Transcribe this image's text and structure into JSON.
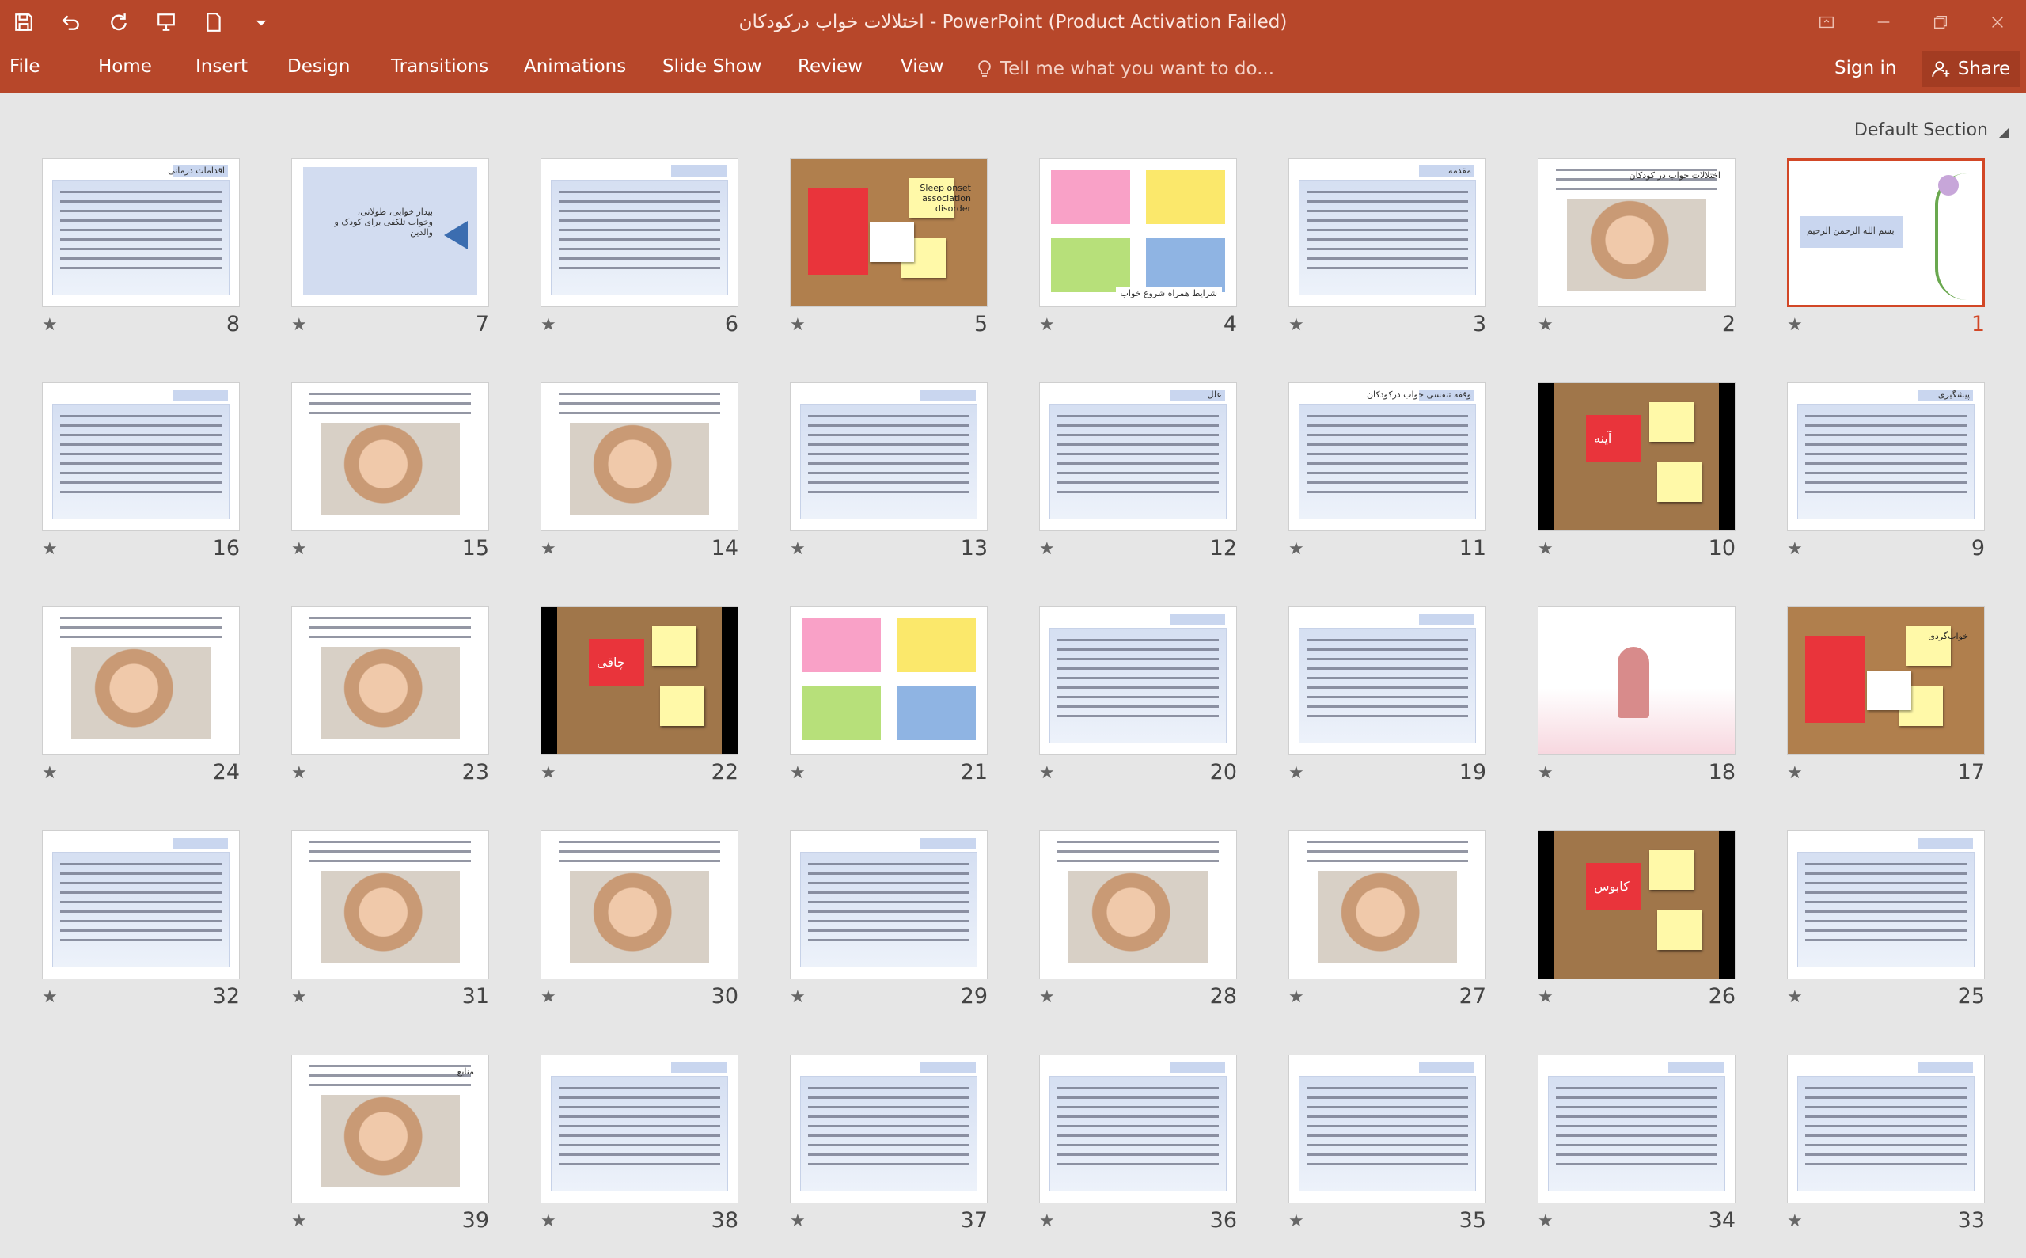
{
  "window": {
    "title": "اختلالات خواب درکودکان - PowerPoint (Product Activation Failed)"
  },
  "ribbon": {
    "tabs": [
      {
        "id": "file",
        "label": "File"
      },
      {
        "id": "home",
        "label": "Home"
      },
      {
        "id": "insert",
        "label": "Insert"
      },
      {
        "id": "design",
        "label": "Design"
      },
      {
        "id": "transitions",
        "label": "Transitions"
      },
      {
        "id": "animations",
        "label": "Animations"
      },
      {
        "id": "slideshow",
        "label": "Slide Show"
      },
      {
        "id": "review",
        "label": "Review"
      },
      {
        "id": "view",
        "label": "View"
      }
    ],
    "tell_me": "Tell me what you want to do...",
    "sign_in": "Sign in",
    "share": "Share"
  },
  "section": {
    "label": "Default Section"
  },
  "slides": [
    {
      "number": "1",
      "selected": true,
      "style": "title",
      "caption": "بسم الله الرحمن الرحیم"
    },
    {
      "number": "2",
      "style": "photo",
      "caption": "اختلالات خواب در کودکان"
    },
    {
      "number": "3",
      "style": "text",
      "caption": "مقدمه"
    },
    {
      "number": "4",
      "style": "sticky",
      "caption": "شرایط همراه شروع خواب"
    },
    {
      "number": "5",
      "style": "cork",
      "caption": "Sleep onset association disorder"
    },
    {
      "number": "6",
      "style": "text",
      "caption": ""
    },
    {
      "number": "7",
      "style": "arrow",
      "caption": "بیدار خوابی، طولانی، وخواب تلکفی برای کودک و والدین"
    },
    {
      "number": "8",
      "style": "text",
      "caption": "اقدامات درمانی"
    },
    {
      "number": "9",
      "style": "text",
      "caption": "پیشگیری"
    },
    {
      "number": "10",
      "style": "black",
      "caption": "آینه"
    },
    {
      "number": "11",
      "style": "text",
      "caption": "وقفه تنفسی خواب درکودکان"
    },
    {
      "number": "12",
      "style": "text",
      "caption": "علل"
    },
    {
      "number": "13",
      "style": "text",
      "caption": ""
    },
    {
      "number": "14",
      "style": "photo",
      "caption": ""
    },
    {
      "number": "15",
      "style": "photo",
      "caption": ""
    },
    {
      "number": "16",
      "style": "text",
      "caption": ""
    },
    {
      "number": "17",
      "style": "cork",
      "caption": "خواب‌گردی"
    },
    {
      "number": "18",
      "style": "girl",
      "caption": ""
    },
    {
      "number": "19",
      "style": "text",
      "caption": ""
    },
    {
      "number": "20",
      "style": "text",
      "caption": ""
    },
    {
      "number": "21",
      "style": "sticky",
      "caption": ""
    },
    {
      "number": "22",
      "style": "black",
      "caption": "چاقی"
    },
    {
      "number": "23",
      "style": "photo",
      "caption": ""
    },
    {
      "number": "24",
      "style": "photo",
      "caption": ""
    },
    {
      "number": "25",
      "style": "text",
      "caption": ""
    },
    {
      "number": "26",
      "style": "black",
      "caption": "کابوس"
    },
    {
      "number": "27",
      "style": "photo",
      "caption": ""
    },
    {
      "number": "28",
      "style": "photo",
      "caption": ""
    },
    {
      "number": "29",
      "style": "text",
      "caption": ""
    },
    {
      "number": "30",
      "style": "photo",
      "caption": ""
    },
    {
      "number": "31",
      "style": "photo",
      "caption": ""
    },
    {
      "number": "32",
      "style": "text",
      "caption": ""
    },
    {
      "number": "33",
      "style": "text",
      "caption": ""
    },
    {
      "number": "34",
      "style": "text",
      "caption": ""
    },
    {
      "number": "35",
      "style": "text",
      "caption": ""
    },
    {
      "number": "36",
      "style": "text",
      "caption": ""
    },
    {
      "number": "37",
      "style": "text",
      "caption": ""
    },
    {
      "number": "38",
      "style": "text",
      "caption": ""
    },
    {
      "number": "39",
      "style": "photo",
      "caption": "منابع"
    }
  ],
  "colors": {
    "ribbon": "#b7472a",
    "selection": "#d24726",
    "canvas": "#e6e6e6"
  }
}
